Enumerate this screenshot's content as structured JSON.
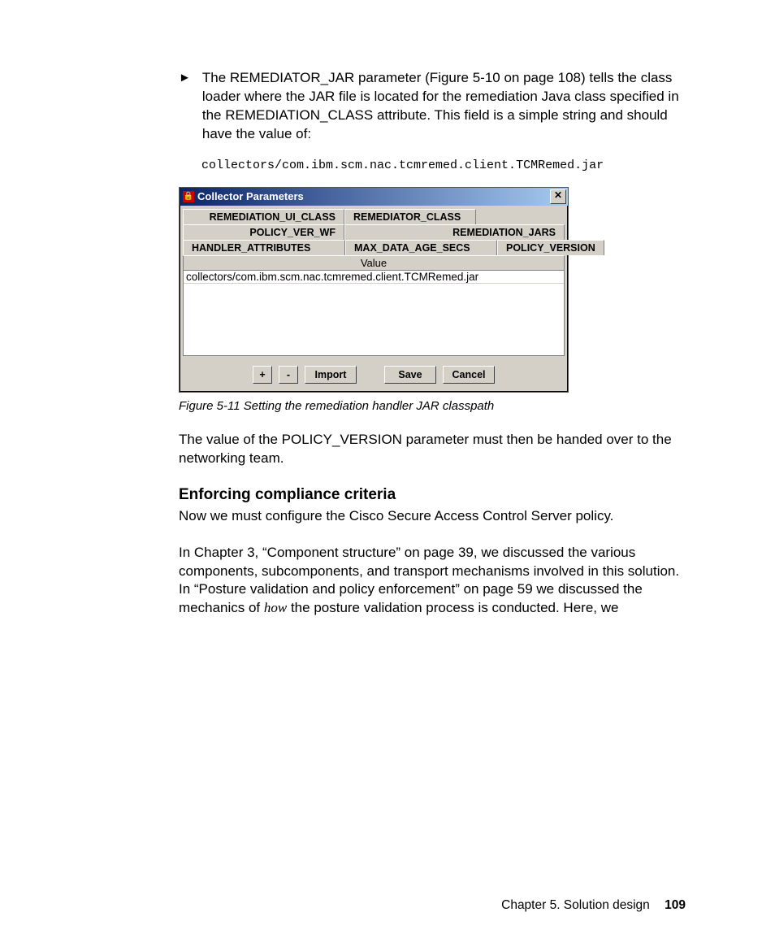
{
  "bullet": {
    "text": "The REMEDIATOR_JAR parameter (Figure 5-10 on page 108) tells the class loader where the JAR file is located for the remediation Java class specified in the REMEDIATION_CLASS attribute. This field is a simple string and should have the value of:"
  },
  "codepath": "collectors/com.ibm.scm.nac.tcmremed.client.TCMRemed.jar",
  "dialog": {
    "title": "Collector Parameters",
    "tabs": {
      "r1": [
        "REMEDIATION_UI_CLASS",
        "REMEDIATOR_CLASS"
      ],
      "r2": [
        "POLICY_VER_WF",
        "REMEDIATION_JARS"
      ],
      "r3": [
        "HANDLER_ATTRIBUTES",
        "MAX_DATA_AGE_SECS",
        "POLICY_VERSION"
      ]
    },
    "value_header": "Value",
    "value_row": "collectors/com.ibm.scm.nac.tcmremed.client.TCMRemed.jar",
    "buttons": {
      "plus": "+",
      "minus": "-",
      "import": "Import",
      "save": "Save",
      "cancel": "Cancel"
    }
  },
  "caption": "Figure 5-11   Setting the remediation handler JAR classpath",
  "para1": "The value of the POLICY_VERSION parameter must then be handed over to the networking team.",
  "heading": "Enforcing compliance criteria",
  "para2": "Now we must configure the Cisco Secure Access Control Server policy.",
  "para3_a": "In Chapter 3, “Component structure” on page 39, we discussed the various components, subcomponents, and transport mechanisms involved in this solution. In “Posture validation and policy enforcement” on page 59 we discussed the mechanics of ",
  "para3_how": "how",
  "para3_b": " the posture validation process is conducted. Here, we",
  "footer": {
    "chapter": "Chapter 5. Solution design",
    "page": "109"
  }
}
